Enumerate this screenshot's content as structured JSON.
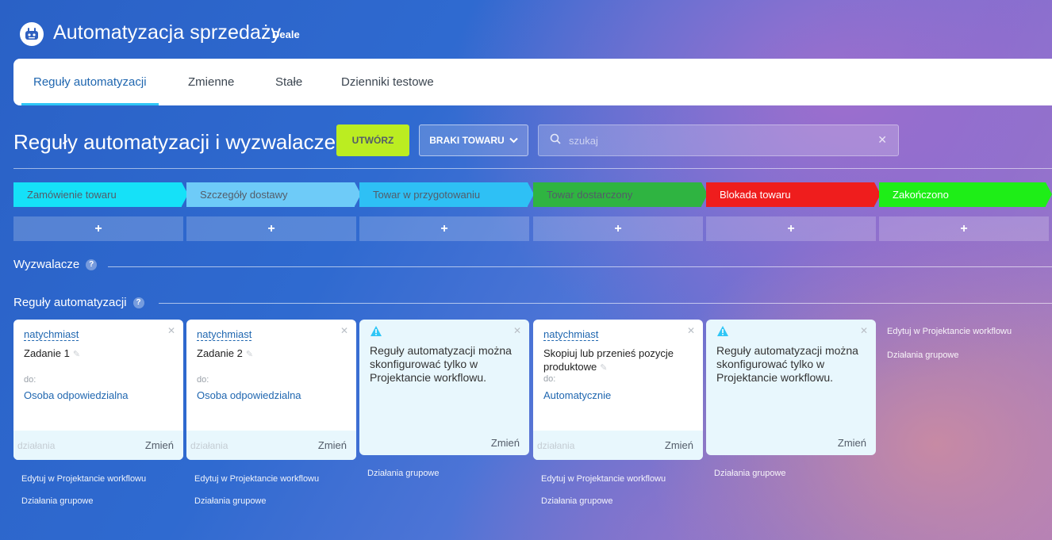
{
  "header": {
    "title": "Automatyzacja sprzedaży",
    "subtitle": "Deale"
  },
  "tabs": [
    {
      "label": "Reguły automatyzacji",
      "active": true
    },
    {
      "label": "Zmienne",
      "active": false
    },
    {
      "label": "Stałe",
      "active": false
    },
    {
      "label": "Dzienniki testowe",
      "active": false
    }
  ],
  "toolbar": {
    "title": "Reguły automatyzacji i wyzwalacze",
    "create_label": "UTWÓRZ",
    "pipeline_label": "BRAKI TOWARU",
    "search_placeholder": "szukaj"
  },
  "stages": [
    {
      "label": "Zamówienie towaru",
      "color": "#15e1f8",
      "text_color": "#535c69"
    },
    {
      "label": "Szczegóły dostawy",
      "color": "#6ecbf8",
      "text_color": "#535c69"
    },
    {
      "label": "Towar w przygotowaniu",
      "color": "#2ec0f5",
      "text_color": "#535c69"
    },
    {
      "label": "Towar dostarczony",
      "color": "#2fb441",
      "text_color": "#535c69"
    },
    {
      "label": "Blokada towaru",
      "color": "#ef1d1d",
      "text_color": "#ffffff"
    },
    {
      "label": "Zakończono",
      "color": "#1eee17",
      "text_color": "#ffffff"
    }
  ],
  "add_label": "+",
  "sections": {
    "triggers": "Wyzwalacze",
    "rules": "Reguły automatyzacji",
    "help": "?"
  },
  "cards": [
    {
      "trigger": "natychmiast",
      "name": "Zadanie 1",
      "to_label": "do:",
      "responsible": "Osoba odpowiedzialna",
      "actions": "działania",
      "change": "Zmień"
    },
    {
      "trigger": "natychmiast",
      "name": "Zadanie 2",
      "to_label": "do:",
      "responsible": "Osoba odpowiedzialna",
      "actions": "działania",
      "change": "Zmień"
    },
    {
      "trigger": "natychmiast",
      "name": "Skopiuj lub przenieś pozycje produktowe",
      "to_label": "do:",
      "responsible": "Automatycznie",
      "actions": "działania",
      "change": "Zmień"
    }
  ],
  "warning": {
    "message": "Reguły automatyzacji można skonfigurować tylko w Projektancie workflowu.",
    "change": "Zmień"
  },
  "links": {
    "edit": "Edytuj w Projektancie workflowu",
    "group": "Działania grupowe"
  },
  "colors": {
    "accent": "#2067b0",
    "create": "#bbed21"
  }
}
